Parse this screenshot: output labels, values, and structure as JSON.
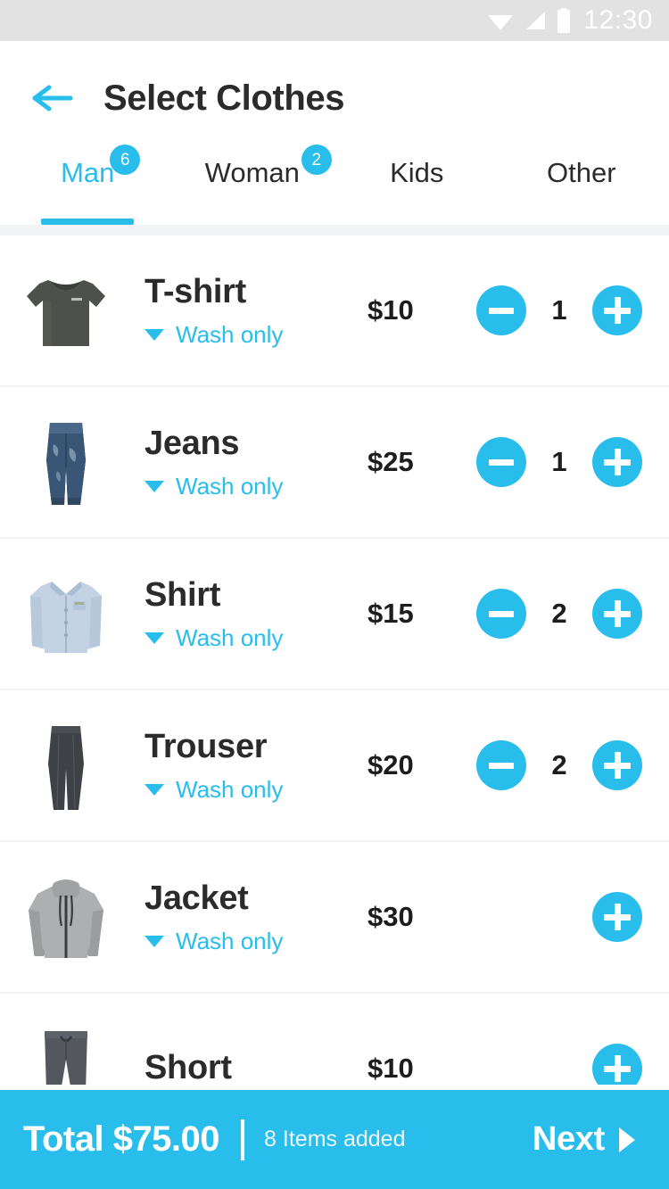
{
  "statusbar": {
    "time": "12:30",
    "icons": [
      "wifi-icon",
      "signal-icon",
      "battery-icon"
    ]
  },
  "header": {
    "back_icon": "back-arrow-icon",
    "title": "Select Clothes"
  },
  "tabs": [
    {
      "label": "Man",
      "badge": "6",
      "active": true
    },
    {
      "label": "Woman",
      "badge": "2",
      "active": false
    },
    {
      "label": "Kids",
      "badge": "",
      "active": false
    },
    {
      "label": "Other",
      "badge": "",
      "active": false
    }
  ],
  "items": [
    {
      "name": "T-shirt",
      "option": "Wash only",
      "price": "$10",
      "qty": "1",
      "has_minus": true,
      "thumb": "tshirt-thumbnail"
    },
    {
      "name": "Jeans",
      "option": "Wash only",
      "price": "$25",
      "qty": "1",
      "has_minus": true,
      "thumb": "jeans-thumbnail"
    },
    {
      "name": "Shirt",
      "option": "Wash only",
      "price": "$15",
      "qty": "2",
      "has_minus": true,
      "thumb": "shirt-thumbnail"
    },
    {
      "name": "Trouser",
      "option": "Wash only",
      "price": "$20",
      "qty": "2",
      "has_minus": true,
      "thumb": "trouser-thumbnail"
    },
    {
      "name": "Jacket",
      "option": "Wash only",
      "price": "$30",
      "qty": "",
      "has_minus": false,
      "thumb": "jacket-thumbnail"
    },
    {
      "name": "Short",
      "option": "",
      "price": "$10",
      "qty": "",
      "has_minus": false,
      "thumb": "short-thumbnail"
    }
  ],
  "bottombar": {
    "total": "Total $75.00",
    "items_added": "8 Items added",
    "next_label": "Next",
    "next_icon": "chevron-right-icon"
  },
  "colors": {
    "accent": "#29bdeb",
    "text_dark": "#2b2b2b",
    "statusbar_bg": "#e2e2e2",
    "divider": "#f1f3f5"
  }
}
